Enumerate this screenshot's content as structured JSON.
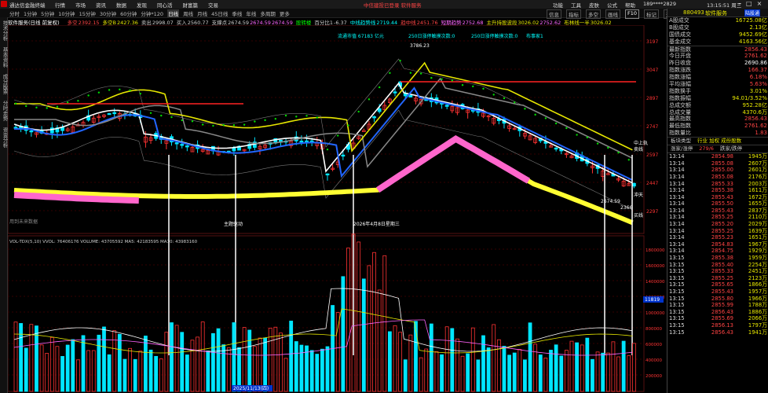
{
  "menubar": {
    "app_name": "通达信金融终端",
    "items": [
      "行情",
      "市场",
      "资讯",
      "数据",
      "发现",
      "同心活",
      "财富篇",
      "交易"
    ],
    "notice": "中信建投已登录  软件服务",
    "right_items": [
      "功能",
      "工具",
      "皮肤",
      "公式",
      "帮助",
      "189****2829"
    ],
    "time": "13:15:51 周三"
  },
  "toolbar": {
    "periods": [
      "分时",
      "1分钟",
      "5分钟",
      "10分钟",
      "15分钟",
      "30分钟",
      "60分钟",
      "分钟*120",
      "日线",
      "周线",
      "月线",
      "45日线",
      "季线",
      "年线",
      "多周期",
      "更多"
    ],
    "active_period": "日线",
    "right_tools": [
      "信息",
      "指标",
      "多空",
      "画线",
      "F10",
      "标记",
      "返回"
    ],
    "active_tool": "F10"
  },
  "left_tabs": [
    "技术分析",
    "基本资料",
    "成分股票",
    "分时走势",
    "资金分析"
  ],
  "info": {
    "title": "软件服务(日线 前复权)",
    "fields": [
      {
        "label": "多空",
        "value": "2392.15",
        "color": "#ff4444"
      },
      {
        "label": "多空B",
        "value": "2427.36",
        "color": "#e6e600"
      },
      {
        "label": "卖出",
        "value": "2998.07",
        "color": "#cccccc"
      },
      {
        "label": "买入",
        "value": "2560.77",
        "color": "#cccccc"
      },
      {
        "label": "支撑点",
        "value": "2674.59",
        "color": "#cccccc"
      },
      {
        "label": "",
        "value": "2674.59",
        "color": "#ff66ff"
      },
      {
        "label": "",
        "value": "2674.59",
        "color": "#ff66ff"
      },
      {
        "label": "股转楼",
        "value": "",
        "color": "#00ff00"
      },
      {
        "label": "百分比1",
        "value": "-6.37",
        "color": "#cccccc"
      },
      {
        "label": "中线趋势线",
        "value": "2719.44",
        "color": "#00ffff"
      },
      {
        "label": "趋中线",
        "value": "2451.76",
        "color": "#ff4444"
      },
      {
        "label": "短期趋势",
        "value": "2752.68",
        "color": "#ff66ff"
      },
      {
        "label": "主升持股波段",
        "value": "3026.02",
        "color": "#e6e600"
      },
      {
        "label": "",
        "value": "2752.62",
        "color": "#ff66ff"
      },
      {
        "label": "布林线一半",
        "value": "3026.02",
        "color": "#e6e600"
      }
    ]
  },
  "annotations": {
    "top_labels": [
      "流通市值 67183 亿元",
      "250日涨停触摸次数:0",
      "250日涨停触摸次数:0",
      "布事家1"
    ],
    "peak_label": "3786.23",
    "dates": [
      "主题驱动",
      "2026年4月8日星期三"
    ],
    "right_marks": [
      "中上轨",
      "卖线",
      "冲天",
      "买线"
    ],
    "low_labels": [
      "2674.59",
      "2366"
    ],
    "note_left": "用到未来数据",
    "bottom_date": "2025/11/13(四)",
    "vol_line": "VOL-TDX(5,10) VVOL: 76406176 VOLUME: 43705592 MA5: 42183595 MA10: 43983160"
  },
  "price_axis": [
    "3197",
    "3047",
    "2897",
    "2747",
    "2597",
    "2447",
    "2297"
  ],
  "vol_axis": [
    "1800000",
    "1600000",
    "1400000",
    "1200000",
    "1000000",
    "800000",
    "600000",
    "400000",
    "200000"
  ],
  "vol_badge": "11819",
  "right_panel": {
    "code": "880493",
    "name": "软件服务",
    "tag": "陆股通",
    "stats": [
      {
        "k": "A股成交",
        "v": "16725.08亿",
        "c": ""
      },
      {
        "k": "B股成交",
        "v": "2.13亿",
        "c": ""
      },
      {
        "k": "国债成交",
        "v": "9452.69亿",
        "c": ""
      },
      {
        "k": "基金成交",
        "v": "4163.56亿",
        "c": ""
      }
    ],
    "stats2": [
      {
        "k": "最新指数",
        "v": "2856.43",
        "c": "red"
      },
      {
        "k": "今日开盘",
        "v": "2761.62",
        "c": "red"
      },
      {
        "k": "昨日收盘",
        "v": "2690.86",
        "c": "white"
      },
      {
        "k": "指数涨跌",
        "v": "166.37",
        "c": "red"
      },
      {
        "k": "指数涨幅",
        "v": "6.18%",
        "c": "red"
      },
      {
        "k": "平均涨幅",
        "v": "5.63%",
        "c": "red"
      },
      {
        "k": "指数换手",
        "v": "3.01%",
        "c": ""
      },
      {
        "k": "指数振幅",
        "v": "94.01/3.52%",
        "c": ""
      },
      {
        "k": "总成交额",
        "v": "952.28亿",
        "c": ""
      },
      {
        "k": "总成交量",
        "v": "4370.6万",
        "c": ""
      },
      {
        "k": "最高指数",
        "v": "2856.43",
        "c": "red"
      },
      {
        "k": "最低指数",
        "v": "2761.62",
        "c": "red"
      },
      {
        "k": "指数量比",
        "v": "1.83",
        "c": "red"
      }
    ],
    "tab_line": [
      "板块类型",
      "行业 加权 成份股数"
    ],
    "ratio_row": [
      "涨家/涨停",
      "279/6",
      "跌家/跌停"
    ],
    "ticks": [
      {
        "t": "13:14",
        "p": "2854.98",
        "q": "1945万"
      },
      {
        "t": "13:14",
        "p": "2855.08",
        "q": "2607万"
      },
      {
        "t": "13:14",
        "p": "2855.00",
        "q": "2601万"
      },
      {
        "t": "13:14",
        "p": "2855.08",
        "q": "2176万"
      },
      {
        "t": "13:14",
        "p": "2855.33",
        "q": "2003万"
      },
      {
        "t": "13:14",
        "p": "2855.38",
        "q": "1611万"
      },
      {
        "t": "13:14",
        "p": "2855.43",
        "q": "1672万"
      },
      {
        "t": "13:14",
        "p": "2855.50",
        "q": "1655万"
      },
      {
        "t": "13:14",
        "p": "2855.43",
        "q": "2837万"
      },
      {
        "t": "13:14",
        "p": "2855.25",
        "q": "2110万"
      },
      {
        "t": "13:14",
        "p": "2855.20",
        "q": "2029万"
      },
      {
        "t": "13:14",
        "p": "2855.25",
        "q": "1639万"
      },
      {
        "t": "13:14",
        "p": "2855.23",
        "q": "1651万"
      },
      {
        "t": "13:14",
        "p": "2854.83",
        "q": "1967万"
      },
      {
        "t": "13:14",
        "p": "2854.75",
        "q": "1929万"
      },
      {
        "t": "13:15",
        "p": "2855.38",
        "q": "1959万"
      },
      {
        "t": "13:15",
        "p": "2855.40",
        "q": "2254万"
      },
      {
        "t": "13:15",
        "p": "2855.33",
        "q": "2451万"
      },
      {
        "t": "13:15",
        "p": "2855.25",
        "q": "2123万"
      },
      {
        "t": "13:15",
        "p": "2855.65",
        "q": "1866万"
      },
      {
        "t": "13:15",
        "p": "2855.43",
        "q": "1957万"
      },
      {
        "t": "13:15",
        "p": "2855.80",
        "q": "1966万"
      },
      {
        "t": "13:15",
        "p": "2855.99",
        "q": "1788万"
      },
      {
        "t": "13:15",
        "p": "2856.43",
        "q": "1886万"
      },
      {
        "t": "13:15",
        "p": "2855.69",
        "q": "2066万"
      },
      {
        "t": "13:15",
        "p": "2856.13",
        "q": "1797万"
      },
      {
        "t": "13:15",
        "p": "2856.43",
        "q": "1941万"
      }
    ]
  },
  "colors": {
    "up": "#ff3333",
    "down": "#00e5ff",
    "axis": "#ff3333",
    "accent": "#e6e600"
  }
}
